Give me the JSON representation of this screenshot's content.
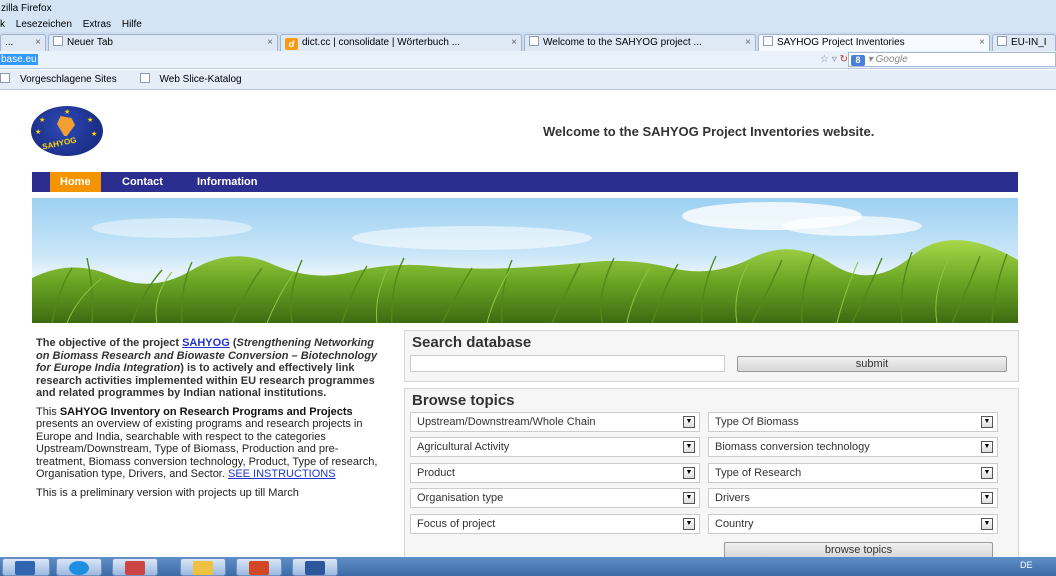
{
  "browser": {
    "title": "zilla Firefox",
    "menu": [
      "k",
      "Lesezeichen",
      "Extras",
      "Hilfe"
    ],
    "tabs": [
      {
        "label": "...",
        "active": false
      },
      {
        "label": "Neuer Tab",
        "active": false
      },
      {
        "label": "dict.cc | consolidate | Wörterbuch ...",
        "active": false
      },
      {
        "label": "Welcome to the SAHYOG project ...",
        "active": false
      },
      {
        "label": "SAYHOG Project Inventories",
        "active": true
      },
      {
        "label": "EU-IN_I",
        "active": false
      }
    ],
    "url": "base.eu",
    "search_placeholder": "Google",
    "bookmarks": [
      "Vorgeschlagene Sites",
      "Web Slice-Katalog"
    ]
  },
  "page": {
    "logo_text": "SAHYOG",
    "welcome": "Welcome to the SAHYOG Project Inventories website.",
    "nav": [
      "Home",
      "Contact",
      "Information"
    ],
    "intro": {
      "lead": "The objective of the project ",
      "link": "SAHYOG",
      "open_paren": " (",
      "expansion": "Strengthening Networking on Biomass Research and Biowaste Conversion – Biotechnology for Europe India Integration",
      "rest": ") is to actively and effectively link research activities implemented within EU research programmes and related programmes by Indian national institutions."
    },
    "desc": {
      "lead": "This ",
      "bold": "SAHYOG Inventory on Research Programs and Projects",
      "rest": " presents an overview of existing programs and research projects in Europe and India, searchable with respect to the categories Upstream/Downstream, Type of Biomass, Production and pre-treatment, Biomass conversion technology, Product, Type of research, Organisation type, Drivers, and Sector. ",
      "link": "SEE INSTRUCTIONS"
    },
    "preliminary": "This is a preliminary version with projects up till March",
    "search": {
      "title": "Search database",
      "submit": "submit"
    },
    "browse": {
      "title": "Browse topics",
      "left_selects": [
        "Upstream/Downstream/Whole Chain",
        "Agricultural Activity",
        "Product",
        "Organisation type",
        "Focus of project"
      ],
      "right_selects": [
        "Type Of Biomass",
        "Biomass conversion technology",
        "Type of Research",
        "Drivers",
        "Country"
      ],
      "button": "browse topics"
    }
  },
  "taskbar": {
    "lang": "DE"
  },
  "colors": {
    "nav_bg": "#2b2d8f",
    "nav_active": "#f39400",
    "link": "#2233cc"
  }
}
